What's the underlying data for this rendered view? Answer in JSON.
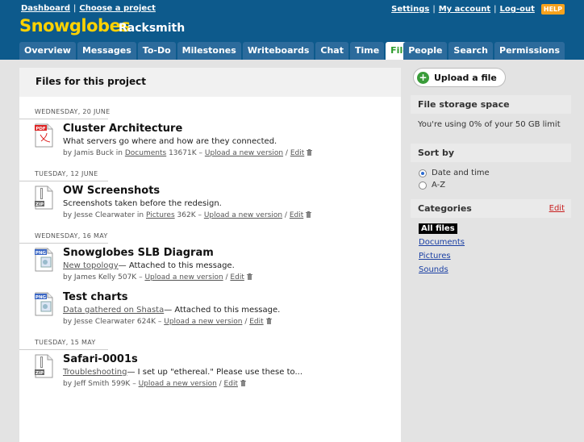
{
  "header": {
    "left_links": [
      "Dashboard",
      "Choose a project"
    ],
    "right_links": [
      "Settings",
      "My account",
      "Log-out"
    ],
    "help": "HELP",
    "company": "Snowglobes",
    "project": "Racksmith"
  },
  "tabs_left": [
    "Overview",
    "Messages",
    "To-Do",
    "Milestones",
    "Writeboards",
    "Chat",
    "Time",
    "Files"
  ],
  "tabs_right": [
    "People",
    "Search",
    "Permissions"
  ],
  "active_tab": "Files",
  "main": {
    "title": "Files for this project",
    "groups": [
      {
        "date": "WEDNESDAY, 20 JUNE",
        "files": [
          {
            "icon": "pdf-icon",
            "icon_label": "PDF",
            "icon_size": "Sldr",
            "title": "Cluster Architecture",
            "desc_link": "",
            "desc": "What servers go where and how are they connected.",
            "by": "by Jamis Buck in",
            "category": "Documents",
            "size": "13671K",
            "upload": "Upload a new version",
            "edit": "Edit"
          }
        ]
      },
      {
        "date": "TUESDAY, 12 JUNE",
        "files": [
          {
            "icon": "zip-icon",
            "icon_label": "ZIP",
            "title": "OW Screenshots",
            "desc_link": "",
            "desc": "Screenshots taken before the redesign.",
            "by": "by Jesse Clearwater in",
            "category": "Pictures",
            "size": "362K",
            "upload": "Upload a new version",
            "edit": "Edit"
          }
        ]
      },
      {
        "date": "WEDNESDAY, 16 MAY",
        "files": [
          {
            "icon": "png-icon",
            "icon_label": "PNG",
            "title": "Snowglobes SLB Diagram",
            "desc_link": "New topology",
            "desc": "— Attached to this message.",
            "by": "by James Kelly",
            "category": "",
            "size": "507K",
            "upload": "Upload a new version",
            "edit": "Edit"
          },
          {
            "icon": "png-icon",
            "icon_label": "PNG",
            "title": "Test charts",
            "desc_link": "Data gathered on Shasta",
            "desc": "— Attached to this message.",
            "by": "by Jesse Clearwater",
            "category": "",
            "size": "624K",
            "upload": "Upload a new version",
            "edit": "Edit"
          }
        ]
      },
      {
        "date": "TUESDAY, 15 MAY",
        "files": [
          {
            "icon": "zip-icon",
            "icon_label": "ZIP",
            "title": "Safari-0001s",
            "desc_link": "Troubleshooting",
            "desc": "— I set up \"ethereal.\" Please use these to...",
            "by": "by Jeff Smith",
            "category": "",
            "size": "599K",
            "upload": "Upload a new version",
            "edit": "Edit"
          }
        ]
      }
    ]
  },
  "sidebar": {
    "upload_label": "Upload a file",
    "storage_title": "File storage space",
    "storage_text": "You're using 0% of your 50 GB limit",
    "sort_title": "Sort by",
    "sort_options": [
      {
        "label": "Date and time",
        "selected": true
      },
      {
        "label": "A-Z",
        "selected": false
      }
    ],
    "categories_title": "Categories",
    "categories_edit": "Edit",
    "categories": [
      {
        "label": "All files",
        "selected": true
      },
      {
        "label": "Documents",
        "selected": false
      },
      {
        "label": "Pictures",
        "selected": false
      },
      {
        "label": "Sounds",
        "selected": false
      }
    ]
  },
  "colors": {
    "header_bg": "#0d5a8c",
    "company": "#ffd200",
    "active_tab": "#2a9a2a",
    "help": "#f7a21c"
  }
}
